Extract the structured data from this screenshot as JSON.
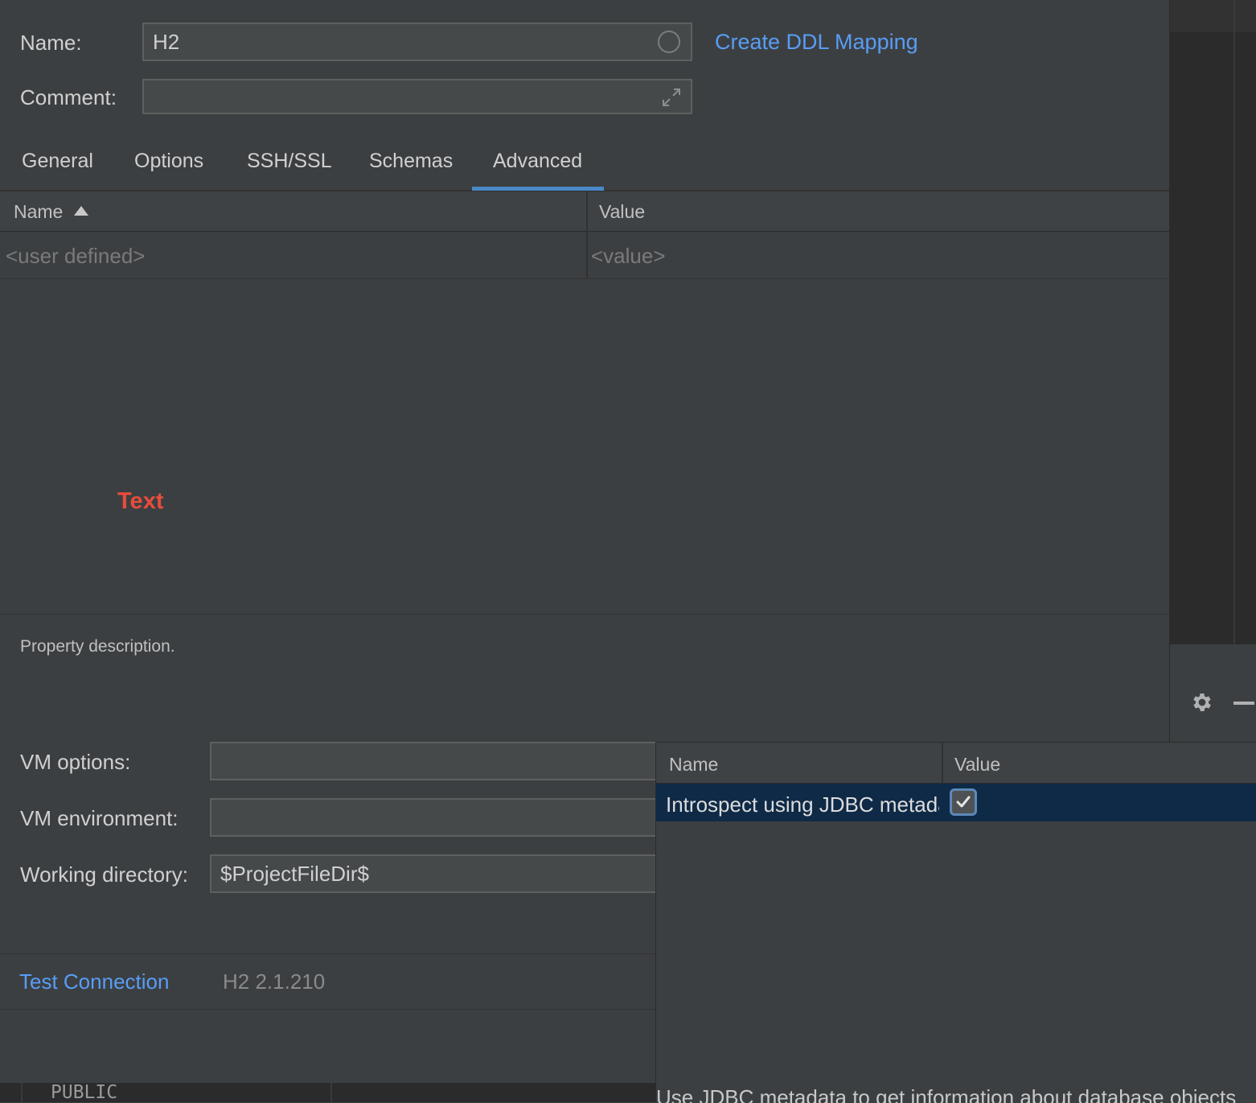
{
  "form": {
    "name_label": "Name:",
    "name_value": "H2",
    "comment_label": "Comment:",
    "comment_value": "",
    "ddl_link": "Create DDL Mapping"
  },
  "tabs": [
    {
      "label": "General"
    },
    {
      "label": "Options"
    },
    {
      "label": "SSH/SSL"
    },
    {
      "label": "Schemas"
    },
    {
      "label": "Advanced",
      "active": true
    }
  ],
  "props_table": {
    "columns": [
      "Name",
      "Value"
    ],
    "sort_indicator": "ascending",
    "placeholder_name": "<user defined>",
    "placeholder_value": "<value>"
  },
  "annotation": "Text",
  "description": "Property description.",
  "vm": {
    "options_label": "VM options:",
    "options_value": "",
    "env_label": "VM environment:",
    "env_value": "",
    "workdir_label": "Working directory:",
    "workdir_value": "$ProjectFileDir$"
  },
  "footer": {
    "test_link": "Test Connection",
    "version": "H2 2.1.210"
  },
  "popup": {
    "columns": [
      "Name",
      "Value"
    ],
    "row_name": "Introspect using JDBC metadata",
    "row_checked": true,
    "description": "Use JDBC metadata to get information about database objects"
  },
  "bottom_strip": {
    "schema": "PUBLIC"
  },
  "colors": {
    "accent": "#589df6",
    "tab_underline": "#4a88c7",
    "annotation_red": "#e74c3c",
    "selected_row": "#0f2a47"
  }
}
